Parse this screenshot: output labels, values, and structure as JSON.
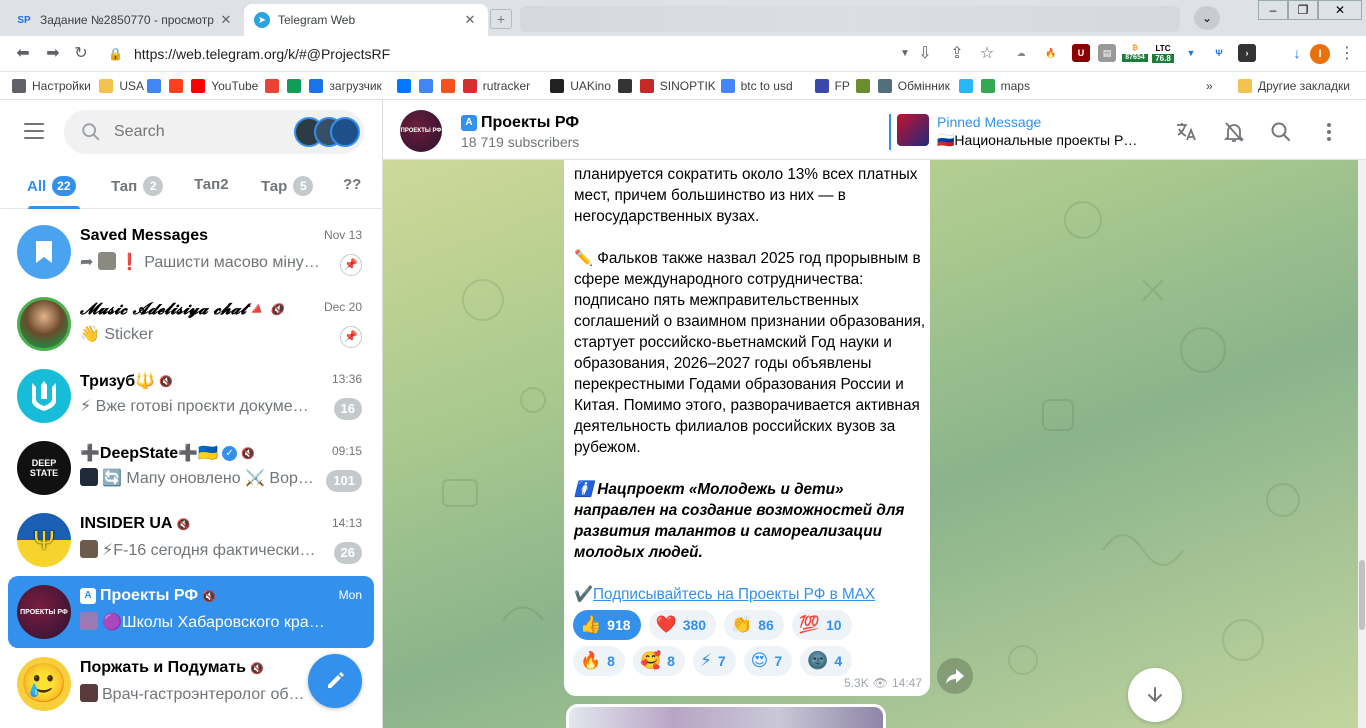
{
  "browser": {
    "tabs": [
      {
        "title": "Задание №2850770 - просмотр з",
        "favicon": "SP"
      },
      {
        "title": "Telegram Web",
        "favicon": "telegram-icon"
      }
    ],
    "url": "https://web.telegram.org/k/#@ProjectsRF",
    "extensions": {
      "ltc_label": "LTC",
      "ltc_value": "76.8",
      "btc_value": "87654",
      "profile_letter": "I"
    },
    "bookmarks": [
      {
        "label": "Настройки",
        "icon": "gear-icon"
      },
      {
        "label": "USA",
        "icon": "folder-icon"
      },
      {
        "label": "",
        "icon": "google-icon"
      },
      {
        "label": "",
        "icon": "yandex-icon"
      },
      {
        "label": "YouTube",
        "icon": "youtube-icon"
      },
      {
        "label": "",
        "icon": "gmail-icon"
      },
      {
        "label": "",
        "icon": "drive-icon"
      },
      {
        "label": "загрузчик",
        "icon": "infinity-icon"
      },
      {
        "label": "",
        "icon": "vk-icon"
      },
      {
        "label": "",
        "icon": "translate-icon"
      },
      {
        "label": "",
        "icon": "f-icon"
      },
      {
        "label": "rutracker",
        "icon": "rutracker-icon"
      },
      {
        "label": "UAKino",
        "icon": "uakino-icon"
      },
      {
        "label": "",
        "icon": "bottle-icon"
      },
      {
        "label": "SINOPTIK",
        "icon": "thermometer-icon"
      },
      {
        "label": "btc to usd",
        "icon": "google-icon"
      },
      {
        "label": "FP",
        "icon": "fp-icon"
      },
      {
        "label": "",
        "icon": "bc-icon"
      },
      {
        "label": "Обмінник",
        "icon": "exchange-icon"
      },
      {
        "label": "",
        "icon": "star-icon"
      },
      {
        "label": "maps",
        "icon": "maps-icon"
      }
    ],
    "bookmarks_more": "»",
    "other_bookmarks": "Другие закладки"
  },
  "sidebar": {
    "search_placeholder": "Search",
    "folders": [
      {
        "label": "All",
        "count": "22"
      },
      {
        "label": "Тап",
        "count": "2"
      },
      {
        "label": "Тап2",
        "count": ""
      },
      {
        "label": "Тар",
        "count": "5"
      },
      {
        "label": "??",
        "count": ""
      }
    ],
    "chats": [
      {
        "name": "Saved Messages",
        "time": "Nov 13",
        "preview": "❗ Рашисти масово міную…",
        "badge": ""
      },
      {
        "name": "𝓜𝓾𝓼𝓲𝓬 𝓐𝓭𝓮𝓵𝓲𝓼𝓲𝔂𝓪 𝓬𝓱𝓪𝓽🔺",
        "time": "Dec 20",
        "preview": "👋 Sticker",
        "badge": ""
      },
      {
        "name": "Тризуб🔱",
        "time": "13:36",
        "preview": "⚡ Вже готові проєкти докуме…",
        "badge": "16"
      },
      {
        "name": "➕DeepState➕🇺🇦",
        "time": "09:15",
        "preview": "🔄 Мапу оновлено ⚔️ Вор…",
        "badge": "101"
      },
      {
        "name": "INSIDER UA",
        "time": "14:13",
        "preview": "⚡F-16 сегодня фактически…",
        "badge": "26"
      },
      {
        "name": "Проекты РФ",
        "time": "Mon",
        "preview": "🟣Школы Хабаровского края об…",
        "badge": ""
      },
      {
        "name": "Поржать и Подумать",
        "time": "",
        "preview": "Врач-гастроэнтеролог об…",
        "badge": ""
      }
    ],
    "deepstate_avatar_text": "DEEP STATE",
    "projects_avatar_text": "ПРОЕКТЫ РФ"
  },
  "channel": {
    "title": "Проекты РФ",
    "subscribers": "18 719 subscribers",
    "avatar_text": "ПРОЕКТЫ РФ",
    "pinned_title": "Pinned Message",
    "pinned_text": "🇷🇺Национальные проекты Р…"
  },
  "message": {
    "p1": "планируется сократить около 13% всех платных мест, причем большинство из них — в негосударственных вузах.",
    "p2": "✏️ Фальков также назвал 2025 год прорывным в сфере международного сотрудничества: подписано пять межправительственных соглашений о взаимном признании образования, стартует российско-вьетнамский Год науки и образования, 2026–2027 годы объявлены перекрестными Годами образования России и Китая. Помимо этого, разворачивается активная деятельность филиалов российских вузов за рубежом.",
    "p3": "🚺 Нацпроект «Молодежь и дети» направлен на создание возможностей для развития талантов и самореализации молодых людей.",
    "link_prefix": "✔️",
    "link": "Подписывайтесь на Проекты РФ в MAX",
    "reactions_row1": [
      {
        "emoji": "👍",
        "count": "918"
      },
      {
        "emoji": "❤️",
        "count": "380"
      },
      {
        "emoji": "👏",
        "count": "86"
      },
      {
        "emoji": "💯",
        "count": "10"
      }
    ],
    "reactions_row2": [
      {
        "emoji": "🔥",
        "count": "8"
      },
      {
        "emoji": "🥰",
        "count": "8"
      },
      {
        "emoji": "⚡",
        "count": "7"
      },
      {
        "emoji": "😍",
        "count": "7"
      },
      {
        "emoji": "🌚",
        "count": "4"
      }
    ],
    "views": "5.3K",
    "time": "14:47"
  },
  "colors": {
    "accent": "#3390ec",
    "muted": "#707579"
  }
}
